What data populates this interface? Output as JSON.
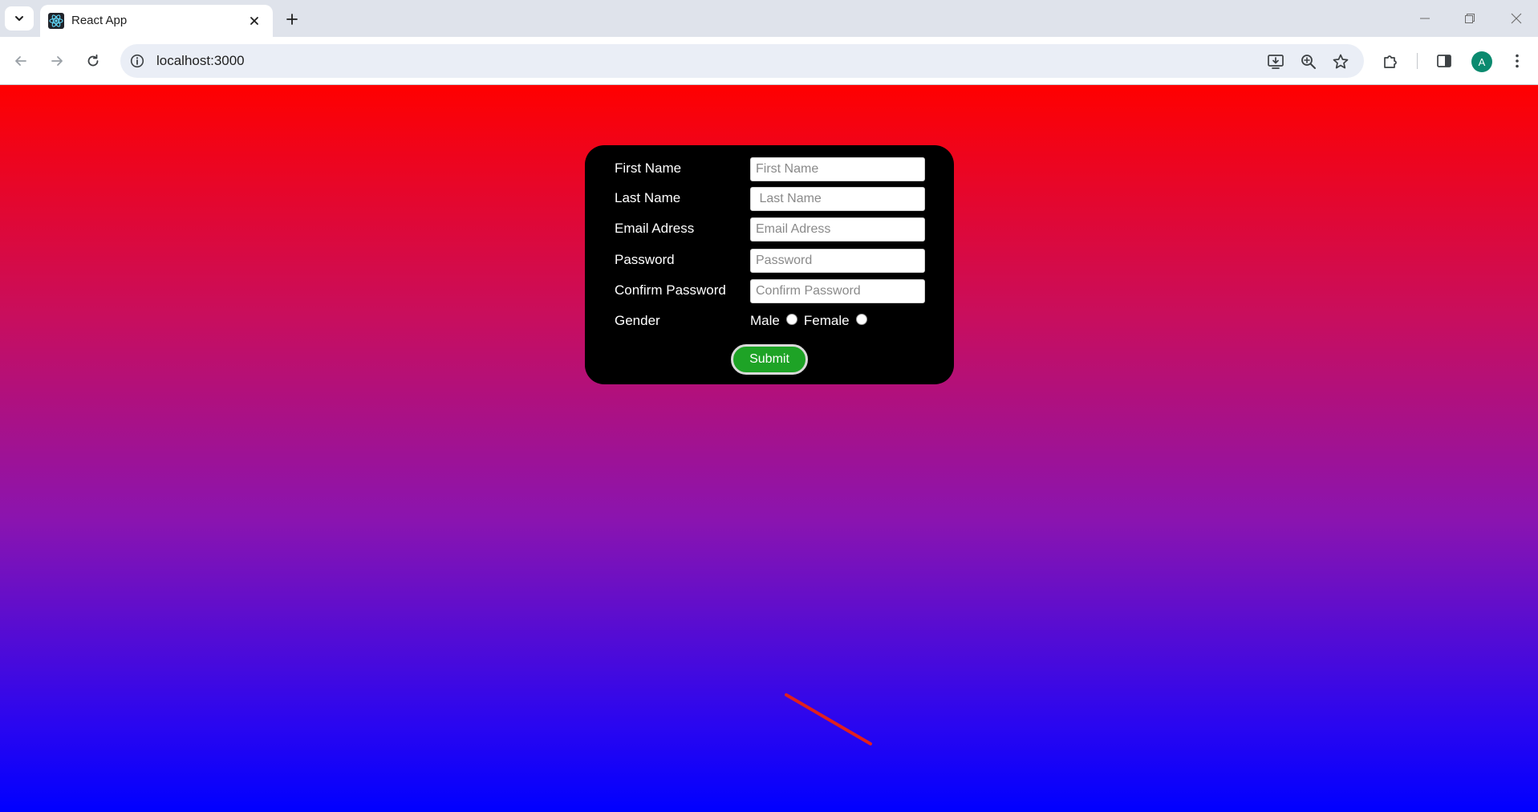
{
  "browser": {
    "tab_title": "React App",
    "url": "localhost:3000",
    "profile_initial": "A",
    "icons": {
      "tab_search": "chevron-down-icon",
      "favicon": "react-logo-icon",
      "tab_close": "close-icon",
      "new_tab": "plus-icon",
      "back": "arrow-left-icon",
      "forward": "arrow-right-icon",
      "reload": "reload-icon",
      "site_info": "info-icon",
      "install": "install-app-icon",
      "zoom": "zoom-icon",
      "bookmark": "star-icon",
      "extensions": "puzzle-icon",
      "side_panel": "side-panel-icon",
      "menu": "kebab-menu-icon"
    }
  },
  "page": {
    "background_gradient": [
      "#ff0000",
      "#c80e5e",
      "#8a14b0",
      "#0000ff"
    ],
    "form": {
      "card_color": "#000000",
      "fields": [
        {
          "label": "First Name",
          "placeholder": "First Name",
          "value": ""
        },
        {
          "label": "Last Name",
          "placeholder": " Last Name",
          "value": ""
        },
        {
          "label": "Email Adress",
          "placeholder": "Email Adress",
          "value": ""
        },
        {
          "label": "Password",
          "placeholder": "Password",
          "value": ""
        },
        {
          "label": "Confirm Password",
          "placeholder": "Confirm Password",
          "value": ""
        }
      ],
      "gender": {
        "label": "Gender",
        "options": [
          "Male",
          "Female"
        ],
        "selected": null
      },
      "submit_label": "Submit",
      "submit_color": "#1ea326"
    },
    "annotation_color": "#e0201e"
  }
}
